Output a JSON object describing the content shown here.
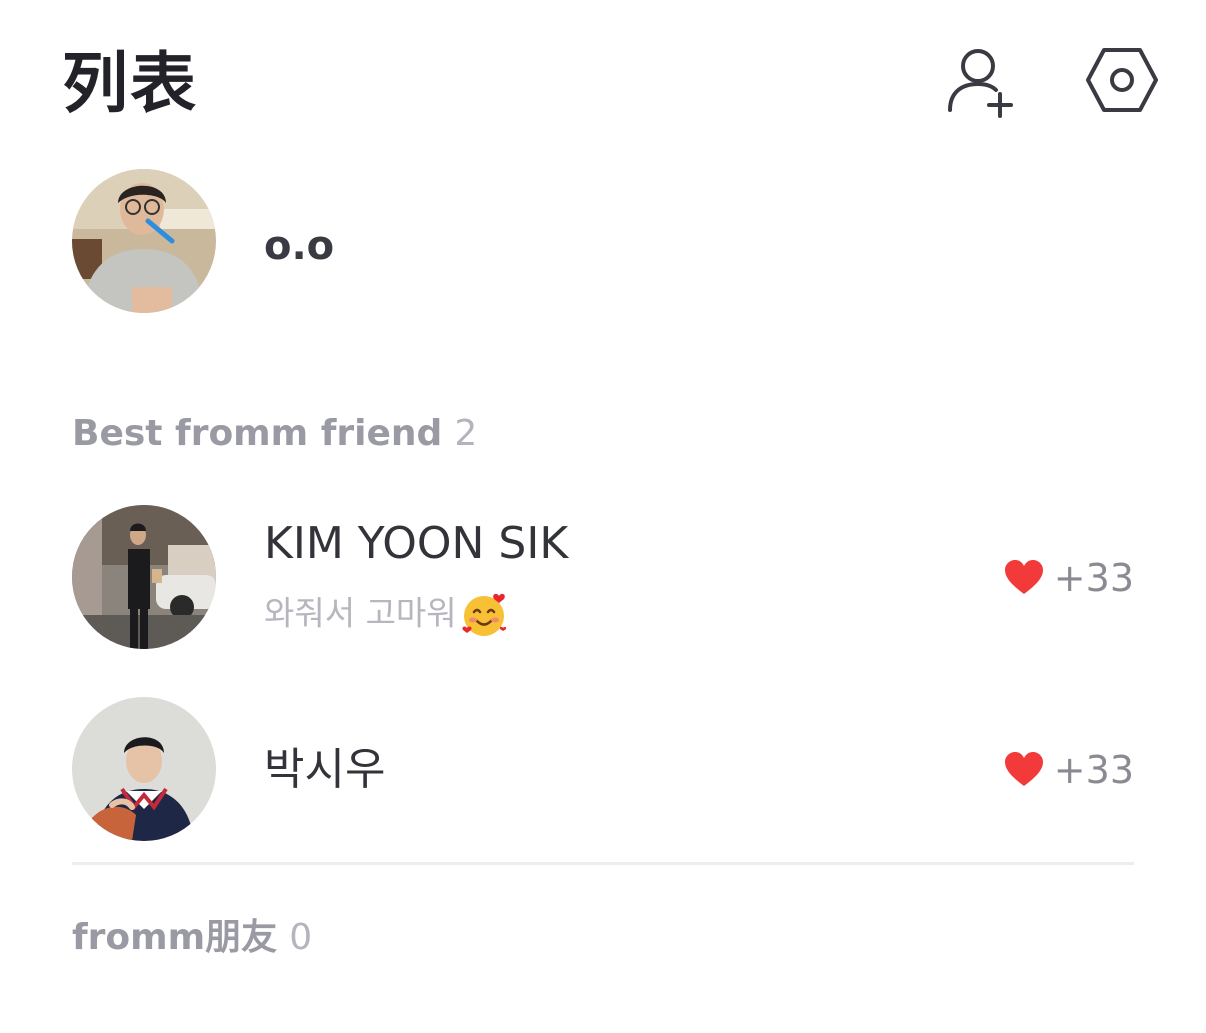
{
  "header": {
    "title": "列表",
    "add_friend_icon": "person-plus-icon",
    "settings_icon": "hexagon-gear-icon"
  },
  "me": {
    "name": "o.o"
  },
  "best_friends": {
    "label": "Best fromm friend",
    "count": "2",
    "items": [
      {
        "name": "KIM YOON SIK",
        "status": "와줘서 고마워",
        "status_emoji": "smiling-face-with-hearts",
        "score": "+33"
      },
      {
        "name": "박시우",
        "status": "",
        "score": "+33"
      }
    ]
  },
  "friends": {
    "label": "fromm朋友",
    "count": "0"
  },
  "colors": {
    "heart": "#f23a3a",
    "section_label": "#9a9aa4",
    "score_text": "#8a8a92"
  }
}
